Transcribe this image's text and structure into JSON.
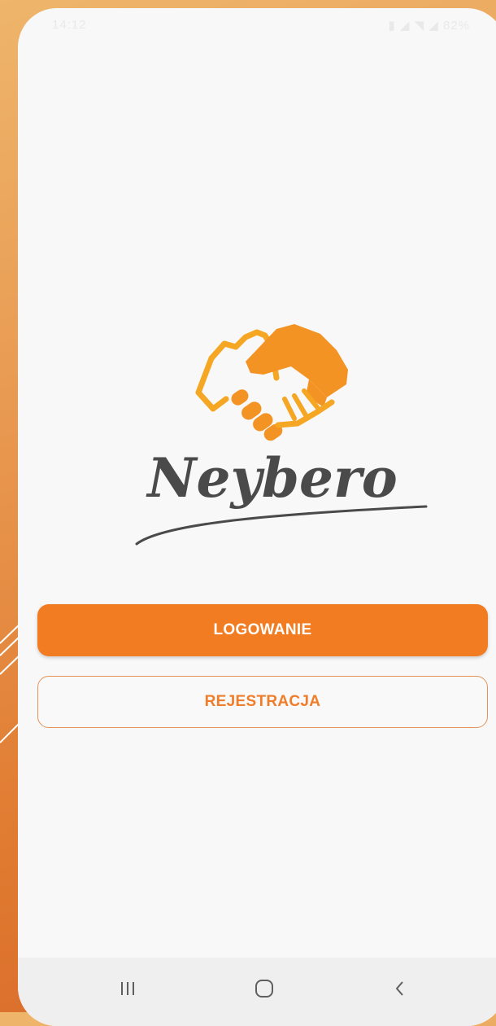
{
  "status_bar": {
    "time": "14:12",
    "icons_text": "▮ ◢ ◥ ◢ 82%"
  },
  "app": {
    "logo_text": "Neybero",
    "logo_icon": "handshake-icon"
  },
  "buttons": {
    "login_label": "LOGOWANIE",
    "register_label": "REJESTRACJA"
  },
  "nav": {
    "recents_icon": "recents-icon",
    "home_icon": "home-icon",
    "back_icon": "back-icon"
  },
  "colors": {
    "accent": "#f27c21",
    "background": "#f8f8f8",
    "logo_text": "#4a4a4a"
  }
}
